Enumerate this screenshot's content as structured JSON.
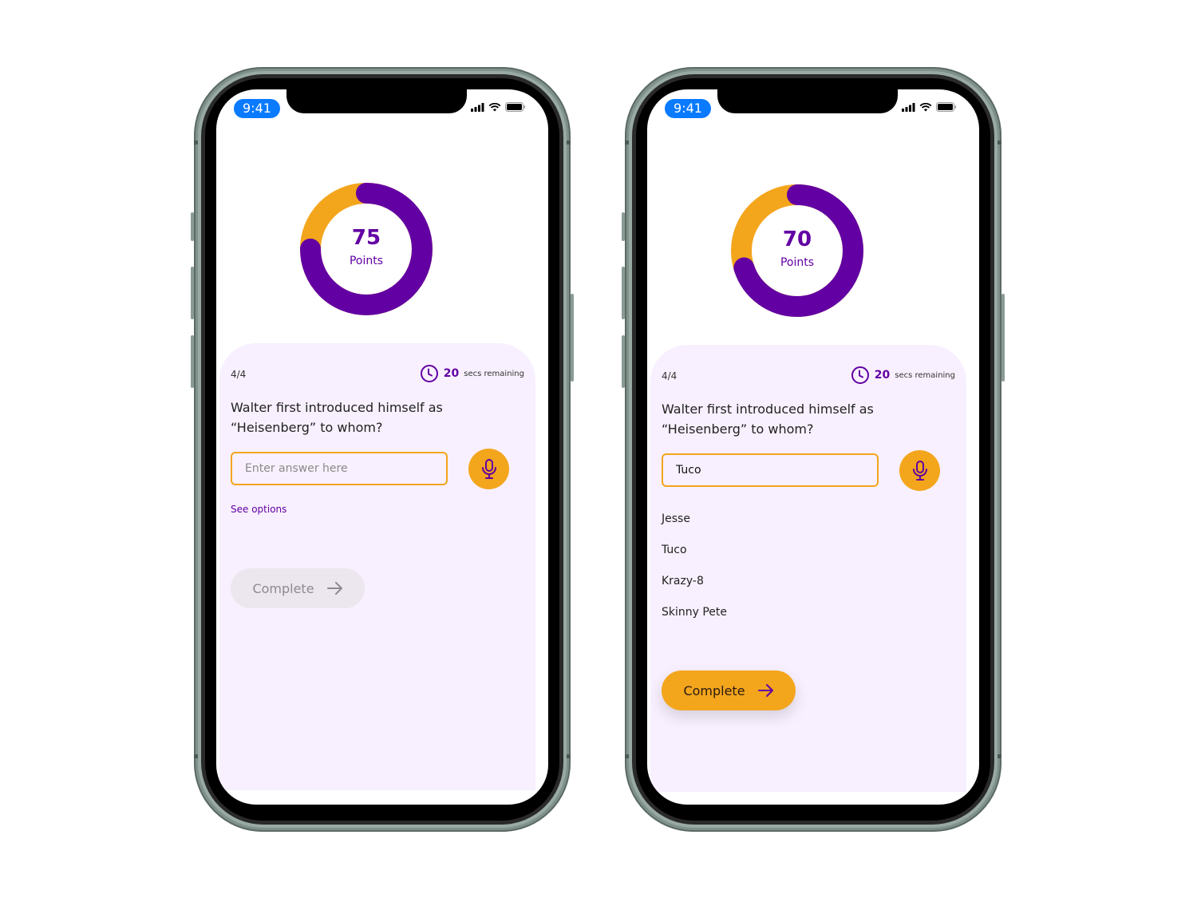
{
  "colors": {
    "accent_orange": "#f3a51c",
    "accent_purple": "#6200a3",
    "card_background": "#f8f0fe",
    "status_pill": "#0a7aff"
  },
  "screens": [
    {
      "status_bar": {
        "time": "9:41",
        "icons": [
          "signal-icon",
          "wifi-icon",
          "battery-icon"
        ]
      },
      "score": {
        "value": "75",
        "label": "Points",
        "purple_fraction": 0.75,
        "orange_fraction": 0.25
      },
      "quiz": {
        "progress": "4/4",
        "timer_value": "20",
        "timer_label": "secs remaining",
        "question": "Walter first introduced himself as “Heisenberg” to whom?",
        "answer_value": "",
        "answer_placeholder": "Enter answer here",
        "see_options_label": "See options",
        "complete_label": "Complete",
        "complete_enabled": false
      }
    },
    {
      "status_bar": {
        "time": "9:41",
        "icons": [
          "signal-icon",
          "wifi-icon",
          "battery-icon"
        ]
      },
      "score": {
        "value": "70",
        "label": "Points",
        "purple_fraction": 0.7,
        "orange_fraction": 0.3
      },
      "quiz": {
        "progress": "4/4",
        "timer_value": "20",
        "timer_label": "secs remaining",
        "question": "Walter first introduced himself as “Heisenberg” to whom?",
        "answer_value": "Tuco",
        "answer_placeholder": "Enter answer here",
        "options": [
          "Jesse",
          "Tuco",
          "Krazy-8",
          "Skinny Pete"
        ],
        "complete_label": "Complete",
        "complete_enabled": true
      }
    }
  ]
}
